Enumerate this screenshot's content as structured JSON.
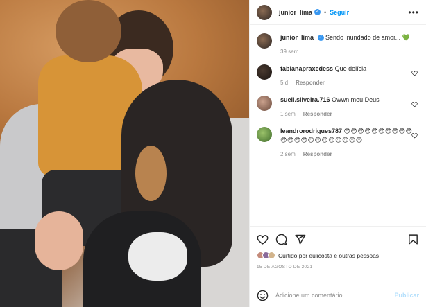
{
  "header": {
    "username": "junior_lima",
    "separator": "•",
    "follow_label": "Seguir",
    "more_label": "•••"
  },
  "caption": {
    "username": "junior_lima",
    "text": "Sendo inundado de amor... 💚",
    "time": "39 sem"
  },
  "comments": [
    {
      "username": "fabianapraxedess",
      "text": "Que delícia",
      "time": "5 d",
      "reply_label": "Responder"
    },
    {
      "username": "sueli.silveira.716",
      "text": "Owwn meu Deus",
      "time": "1 sem",
      "reply_label": "Responder"
    },
    {
      "username": "leandrorodrigues787",
      "text": "😎😎😎😎😎😎😎😎😎😎😎😎😎😎😍😍😍😍😍😍😍😍",
      "time": "2 sem",
      "reply_label": "Responder"
    }
  ],
  "likes": {
    "text": "Curtido por eulicosta e outras pessoas"
  },
  "date": "15 DE AGOSTO DE 2021",
  "add_comment": {
    "placeholder": "Adicione um comentário...",
    "publish_label": "Publicar"
  },
  "colors": {
    "accent": "#0095f6",
    "verified": "#3897f0",
    "muted": "#8e8e8e"
  }
}
